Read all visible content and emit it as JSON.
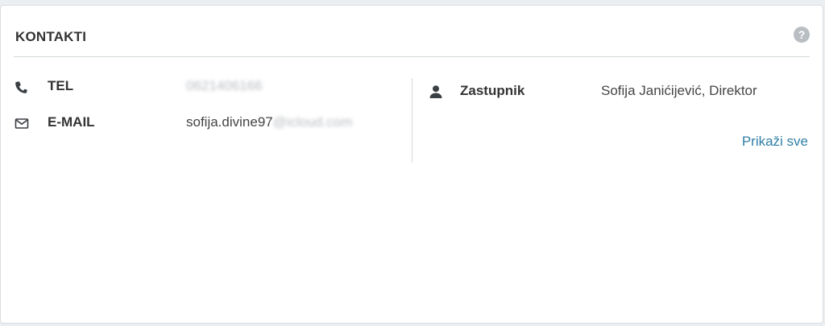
{
  "panel": {
    "title": "KONTAKTI",
    "help_symbol": "?"
  },
  "contacts": {
    "phone": {
      "icon": "phone-icon",
      "label": "TEL",
      "value": "0621406166"
    },
    "email": {
      "icon": "envelope-icon",
      "label": "E-MAIL",
      "value_visible": "sofija.divine97",
      "value_blurred": "@icloud.com"
    }
  },
  "representative": {
    "icon": "user-icon",
    "label": "Zastupnik",
    "value": "Sofija Janićijević, Direktor"
  },
  "show_all_link": "Prikaži sve",
  "colors": {
    "link": "#2f7fa6",
    "text": "#333333",
    "help_icon": "#b9bec3"
  }
}
